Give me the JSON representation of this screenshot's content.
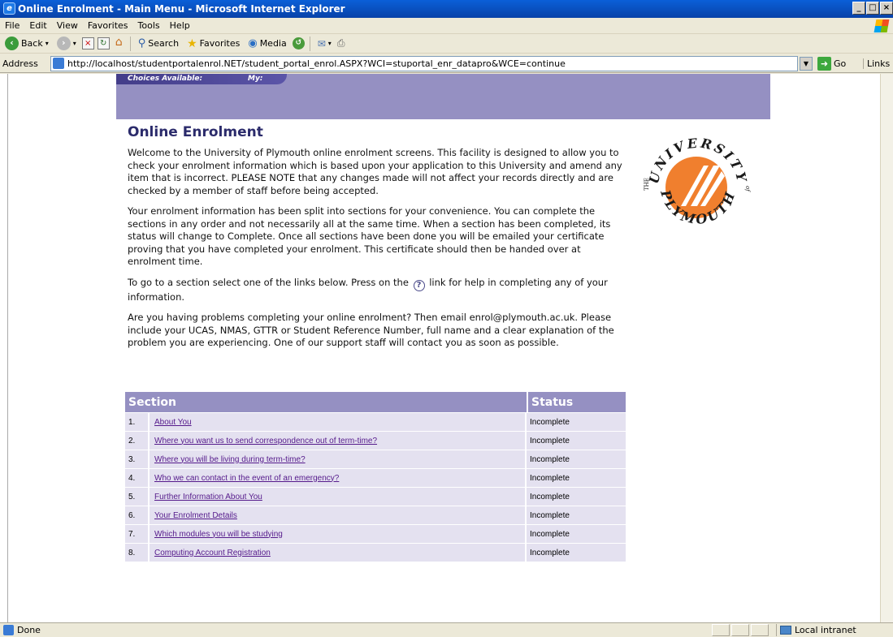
{
  "window": {
    "title": "Online Enrolment - Main Menu - Microsoft Internet Explorer"
  },
  "menu": [
    "File",
    "Edit",
    "View",
    "Favorites",
    "Tools",
    "Help"
  ],
  "toolbar": {
    "back": "Back",
    "search": "Search",
    "favorites": "Favorites",
    "media": "Media"
  },
  "address": {
    "label": "Address",
    "url": "http://localhost/studentportalenrol.NET/student_portal_enrol.ASPX?WCI=stuportal_enr_datapro&WCE=continue",
    "go": "Go",
    "links": "Links"
  },
  "nav": {
    "choices": "Choices Available:",
    "my": "My:"
  },
  "page": {
    "title": "Online Enrolment",
    "p1": "Welcome to the University of Plymouth online enrolment screens.  This facility is designed to allow you to check your enrolment information which is based upon your application to this University and amend any item that is incorrect.  PLEASE NOTE that any changes made will not affect your records directly and are checked by a member of staff before being accepted.",
    "p2": "Your enrolment information has been split into sections for your convenience. You can complete the sections in any order and not necessarily all at the same time.  When a section has been completed, its status will change to Complete.  Once all sections have been done you will be emailed your certificate proving that you have completed your enrolment.  This certificate should then be handed over at enrolment time.",
    "p3_before": "To go to a section select one of the links below.  Press on the",
    "p3_after": "link for help in completing any of your information.",
    "p4": "Are you having problems completing your online enrolment?  Then email enrol@plymouth.ac.uk. Please include your UCAS, NMAS, GTTR or Student Reference Number, full name and a clear explanation of the problem you are experiencing.  One of our support staff will contact you as soon as possible."
  },
  "logo": {
    "top": "UNIVERSITY",
    "bottom": "PLYMOUTH",
    "the": "THE",
    "of": "of",
    "colors": {
      "orange": "#f07f2e",
      "ink": "#1a1a1a"
    }
  },
  "table": {
    "headers": {
      "section": "Section",
      "status": "Status"
    },
    "rows": [
      {
        "num": "1.",
        "label": "About You",
        "status": "Incomplete"
      },
      {
        "num": "2.",
        "label": "Where you want us to send correspondence out of term-time?",
        "status": "Incomplete"
      },
      {
        "num": "3.",
        "label": "Where you will be living during term-time?",
        "status": "Incomplete"
      },
      {
        "num": "4.",
        "label": "Who we can contact in the event of an emergency?",
        "status": "Incomplete"
      },
      {
        "num": "5.",
        "label": "Further Information About You",
        "status": "Incomplete"
      },
      {
        "num": "6.",
        "label": "Your Enrolment Details",
        "status": "Incomplete"
      },
      {
        "num": "7.",
        "label": "Which modules you will be studying",
        "status": "Incomplete"
      },
      {
        "num": "8.",
        "label": "Computing Account Registration",
        "status": "Incomplete"
      }
    ]
  },
  "status": {
    "text": "Done",
    "zone": "Local intranet"
  },
  "colors": {
    "nav_strip": "#9590c2",
    "row_bg": "#e4e1f0",
    "link": "#551a8b",
    "title": "#2b2b6b"
  }
}
